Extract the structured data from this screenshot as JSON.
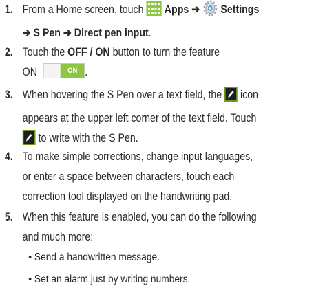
{
  "steps": [
    {
      "number": "1.",
      "lead": "From a Home screen, touch",
      "apps": "Apps",
      "arrow1": "➔",
      "settings": "Settings",
      "line2": "➔ S Pen ➔ Direct pen input",
      "end": "."
    },
    {
      "number": "2.",
      "lead": "Touch the",
      "button": "OFF / ON",
      "rest": "button to turn the feature",
      "line2": "ON",
      "end": ".",
      "toggle_label": "ON"
    },
    {
      "number": "3.",
      "line1a": "When hovering the S Pen over a text field, the",
      "line1b": "icon",
      "line2": "appears at the upper left corner of the text field. Touch",
      "line3": "to write with the S Pen."
    },
    {
      "number": "4.",
      "line1": "To make simple corrections, change input languages,",
      "line2": "or enter a space between characters, touch each",
      "line3": "correction tool displayed on the handwriting pad."
    },
    {
      "number": "5.",
      "line1": "When this feature is enabled, you can do the following",
      "line2": "and much more:"
    }
  ],
  "bullets": [
    "• Send a handwritten message.",
    "• Set an alarm just by writing numbers."
  ],
  "colors": {
    "apps_icon": "#8dc63f",
    "toggle_on": "#8dc63f",
    "pen_icon": "#6a9a1f",
    "text": "#2a2a2a"
  },
  "icons": [
    "apps-grid-icon",
    "settings-gear-icon",
    "pen-input-icon"
  ]
}
